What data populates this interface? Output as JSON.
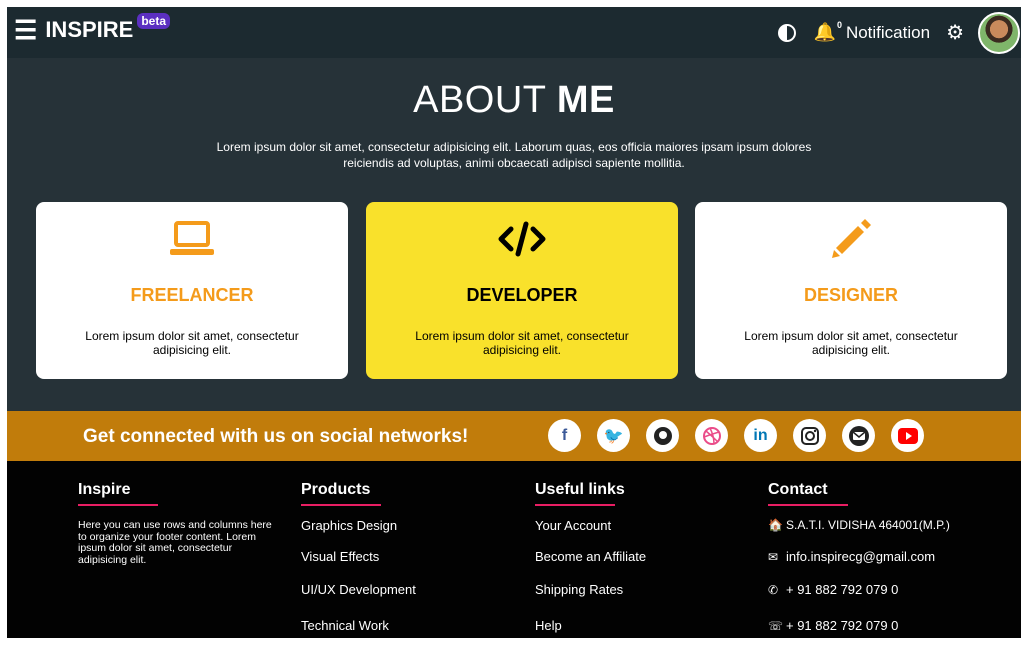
{
  "nav": {
    "brand": "INSPIRE",
    "badge": "beta",
    "notification_count": "0",
    "notification_label": "Notification"
  },
  "about": {
    "title_light": "ABOUT ",
    "title_bold": "ME",
    "text": "Lorem ipsum dolor sit amet, consectetur adipisicing elit. Laborum quas, eos officia maiores ipsam ipsum dolores reiciendis ad voluptas, animi obcaecati adipisci sapiente mollitia."
  },
  "cards": [
    {
      "title": "FREELANCER",
      "text": "Lorem ipsum dolor sit amet, consectetur adipisicing elit.",
      "icon": "laptop-icon"
    },
    {
      "title": "DEVELOPER",
      "text": "Lorem ipsum dolor sit amet, consectetur adipisicing elit.",
      "icon": "code-icon"
    },
    {
      "title": "DESIGNER",
      "text": "Lorem ipsum dolor sit amet, consectetur adipisicing elit.",
      "icon": "pencil-icon"
    }
  ],
  "social": {
    "text": "Get connected with us on social networks!",
    "icons": [
      "facebook-icon",
      "twitter-icon",
      "github-icon",
      "dribbble-icon",
      "linkedin-icon",
      "instagram-icon",
      "email-icon",
      "youtube-icon"
    ]
  },
  "footer": {
    "inspire": {
      "heading": "Inspire",
      "desc": "Here you can use rows and columns here to organize your footer content. Lorem ipsum dolor sit amet, consectetur adipisicing elit."
    },
    "products": {
      "heading": "Products",
      "links": [
        "Graphics Design",
        "Visual Effects",
        "UI/UX Development",
        "Technical Work"
      ]
    },
    "useful": {
      "heading": "Useful links",
      "links": [
        "Your Account",
        "Become an Affiliate",
        "Shipping Rates",
        "Help"
      ]
    },
    "contact": {
      "heading": "Contact",
      "address": "S.A.T.I. VIDISHA 464001(M.P.)",
      "email": "info.inspirecg@gmail.com",
      "phone": "+ 91 882 792 079 0",
      "whatsapp": "+ 91 882 792 079 0"
    }
  },
  "colors": {
    "background": "#263238",
    "navbar": "#1c2a30",
    "accent_orange": "#f49b1b",
    "highlight_yellow": "#f9e12b",
    "social_band": "#c17c0b",
    "footer": "#020202",
    "underline": "#e91e63"
  }
}
